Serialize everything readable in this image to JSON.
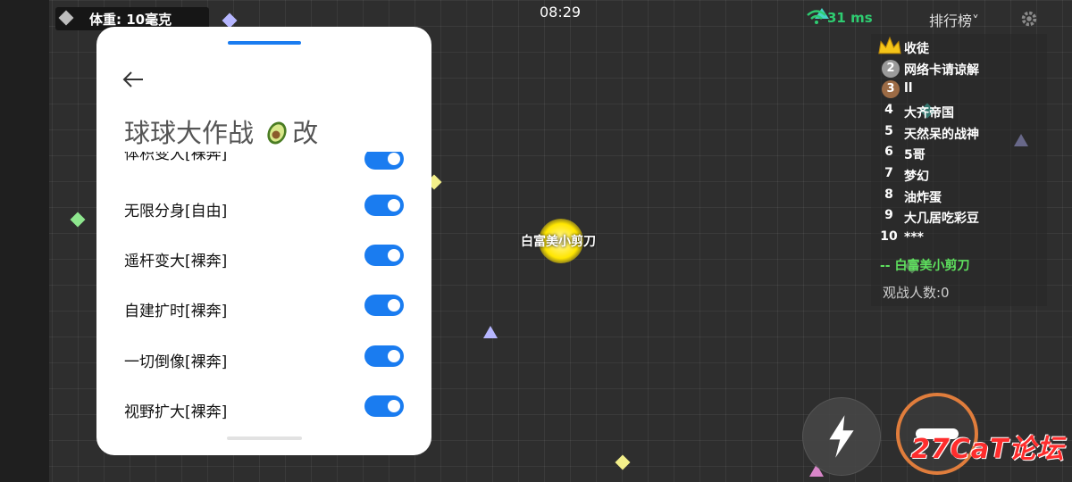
{
  "hud": {
    "weight": "体重: 10毫克",
    "clock": "08:29",
    "ping": "31 ms",
    "leaderboard_title": "排行榜˅"
  },
  "leaderboard": {
    "entries": [
      {
        "rank": "",
        "name": "收徒",
        "medal": "crown-icon"
      },
      {
        "rank": "2",
        "name": "网络卡请谅解",
        "medal": "silver-medal"
      },
      {
        "rank": "3",
        "name": "ll",
        "medal": "bronze-medal"
      },
      {
        "rank": "4",
        "name": "大齐帝国"
      },
      {
        "rank": "5",
        "name": "天然呆的战神"
      },
      {
        "rank": "6",
        "name": "5哥"
      },
      {
        "rank": "7",
        "name": "梦幻"
      },
      {
        "rank": "8",
        "name": "油炸蛋"
      },
      {
        "rank": "9",
        "name": "大几居吃彩豆"
      },
      {
        "rank": "10",
        "name": "***"
      }
    ],
    "self_entry": "-- 白富美小剪刀",
    "spectators": "观战人数:0"
  },
  "player": {
    "name": "白富美小剪刀"
  },
  "watermark": "27CaT论坛",
  "menu": {
    "title_pre": "球球大作战 ",
    "title_post": "改",
    "icon": "avocado-icon",
    "options": [
      {
        "label": "体积变大[裸奔]",
        "enabled": true
      },
      {
        "label": "无限分身[自由]",
        "enabled": true
      },
      {
        "label": "遥杆变大[裸奔]",
        "enabled": true
      },
      {
        "label": "自建扩时[裸奔]",
        "enabled": true
      },
      {
        "label": "一切倒像[裸奔]",
        "enabled": true
      },
      {
        "label": "视野扩大[裸奔]",
        "enabled": true
      }
    ]
  },
  "colors": {
    "accent": "#1a7cf0",
    "ping": "#2ecc71",
    "self": "#5ee05e",
    "eject_ring": "#e07d3c",
    "watermark": "#ff2d2d"
  }
}
